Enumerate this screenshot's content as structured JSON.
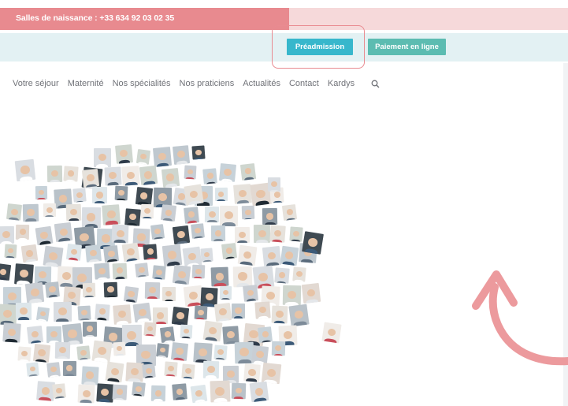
{
  "topbar": {
    "birth_room": "Salles de naissance : +33 634 92 03 02 35"
  },
  "actions": {
    "preadmission": "Préadmission",
    "payment": "Paiement en ligne"
  },
  "nav": {
    "items": [
      "Votre séjour",
      "Maternité",
      "Nos spécialités",
      "Nos praticiens",
      "Actualités",
      "Contact",
      "Kardys"
    ]
  },
  "icons": {
    "search": "search-icon",
    "arrow": "curved-arrow-icon"
  },
  "colors": {
    "accent_pink": "#e88a8f",
    "light_pink": "#f6d9da",
    "teal": "#37b7cc",
    "green_teal": "#5cbcb1",
    "subbar": "#e3f1f3"
  }
}
